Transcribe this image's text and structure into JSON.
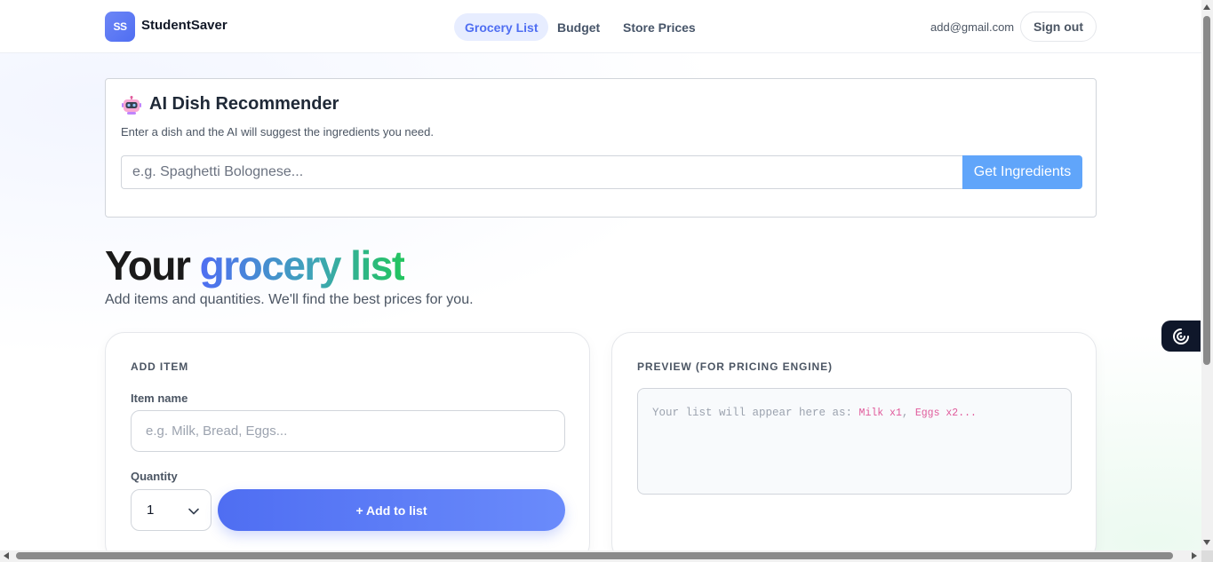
{
  "header": {
    "logo_text": "SS",
    "brand": "StudentSaver",
    "nav": [
      {
        "label": "Grocery List",
        "active": true
      },
      {
        "label": "Budget",
        "active": false
      },
      {
        "label": "Store Prices",
        "active": false
      }
    ],
    "user_email": "add@gmail.com",
    "sign_out_label": "Sign out"
  },
  "ai_card": {
    "icon": "robot-icon",
    "title": "AI Dish Recommender",
    "description": "Enter a dish and the AI will suggest the ingredients you need.",
    "input_placeholder": "e.g. Spaghetti Bolognese...",
    "button_label": "Get Ingredients"
  },
  "hero": {
    "title_plain": "Your",
    "title_highlight": "grocery list",
    "subtitle": "Add items and quantities. We'll find the best prices for you."
  },
  "add_item": {
    "heading": "ADD ITEM",
    "item_name_label": "Item name",
    "item_name_placeholder": "e.g. Milk, Bread, Eggs...",
    "quantity_label": "Quantity",
    "quantity_value": "1",
    "add_button_label": "+ Add to list"
  },
  "preview": {
    "heading": "PREVIEW (FOR PRICING ENGINE)",
    "text_prefix": "Your list will appear here as: ",
    "token_1": "Milk x1",
    "separator": ", ",
    "token_2": "Eggs x2",
    "suffix": "..."
  },
  "colors": {
    "accent": "#4f6ef2",
    "ai_button": "#60a5fa",
    "gradient_end": "#22c55e",
    "code_token": "#e05a9b"
  }
}
